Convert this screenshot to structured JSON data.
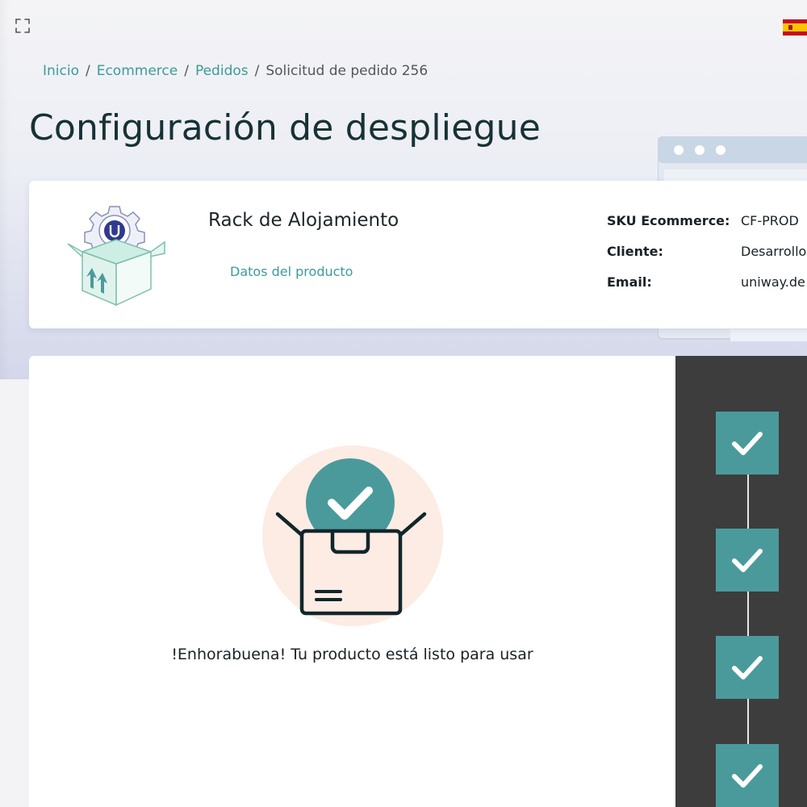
{
  "colors": {
    "accent": "#4a9a9c",
    "link": "#3d9a9a",
    "title": "#173236",
    "steps_panel_bg": "#3d3d3d",
    "illustration_bg": "#fcece4"
  },
  "header": {
    "expand_icon": "fullscreen-expand-icon",
    "language_flag": "spain-flag-icon"
  },
  "breadcrumb": {
    "items": [
      "Inicio",
      "Ecommerce",
      "Pedidos"
    ],
    "separator": "/",
    "current": "Solicitud de pedido 256"
  },
  "page": {
    "title": "Configuración de despliegue"
  },
  "product": {
    "image_icon": "gear-box-product-icon",
    "name": "Rack de Alojamiento",
    "data_link": "Datos del producto",
    "meta": [
      {
        "label": "SKU Ecommerce:",
        "value": "CF-PROD"
      },
      {
        "label": "Cliente:",
        "value": "Desarrollo"
      },
      {
        "label": "Email:",
        "value": "uniway.de"
      }
    ]
  },
  "result": {
    "illustration_icon": "open-box-check-icon",
    "message": "!Enhorabuena! Tu producto está listo para usar"
  },
  "steps": {
    "count": 4,
    "completed": 4,
    "icon": "check-icon"
  }
}
